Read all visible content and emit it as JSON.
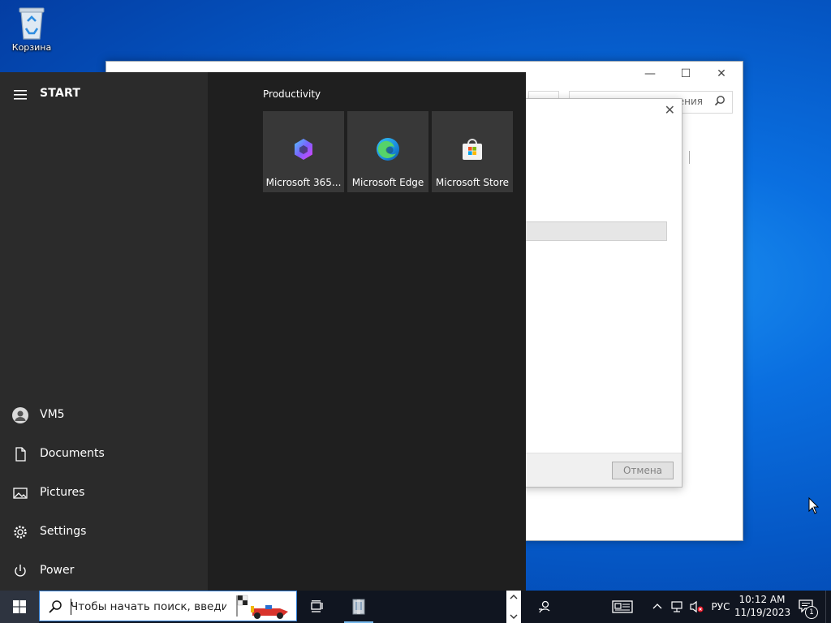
{
  "desktop": {
    "recycle_bin_label": "Корзина"
  },
  "explorer": {
    "search_placeholder": "ения",
    "minimize": "—",
    "maximize": "☐",
    "close": "✕"
  },
  "dialog": {
    "close": "✕",
    "cancel_label": "Отмена"
  },
  "start_menu": {
    "title": "START",
    "nav": [
      {
        "label": "VM5",
        "icon": "user-avatar-icon"
      },
      {
        "label": "Documents",
        "icon": "document-icon"
      },
      {
        "label": "Pictures",
        "icon": "pictures-icon"
      },
      {
        "label": "Settings",
        "icon": "gear-icon"
      },
      {
        "label": "Power",
        "icon": "power-icon"
      }
    ],
    "group_title": "Productivity",
    "tiles": [
      {
        "label": "Microsoft 365...",
        "icon": "microsoft-365-icon"
      },
      {
        "label": "Microsoft Edge",
        "icon": "edge-icon"
      },
      {
        "label": "Microsoft Store",
        "icon": "store-icon"
      }
    ]
  },
  "taskbar": {
    "search_placeholder": "Чтобы начать поиск, введи",
    "language": "РУС",
    "time": "10:12 AM",
    "date": "11/19/2023",
    "notification_count": "1"
  },
  "colors": {
    "accent": "#2f7dd6",
    "start_left": "#2b2b2b",
    "start_right": "#1f1f1f",
    "tile": "#383838",
    "taskbar": "#101520"
  }
}
